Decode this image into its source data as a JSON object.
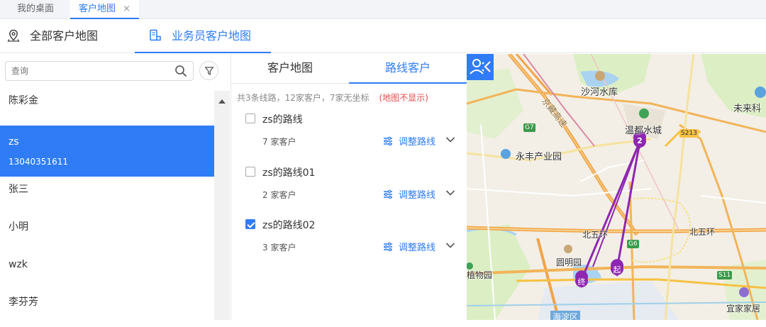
{
  "page_tabs": [
    {
      "label": "我的桌面"
    },
    {
      "label": "客户地图",
      "close": "×"
    }
  ],
  "map_modes": [
    {
      "label": "全部客户地图",
      "icon": "map-pin-icon"
    },
    {
      "label": "业务员客户地图",
      "icon": "person-map-icon"
    }
  ],
  "search": {
    "placeholder": "查询"
  },
  "salespersons": [
    {
      "name": "陈彩金"
    },
    {
      "name": "zs",
      "phone": "13040351611"
    },
    {
      "name": "张三"
    },
    {
      "name": "小明"
    },
    {
      "name": "wzk"
    },
    {
      "name": "李芬芳"
    }
  ],
  "sub_tabs": [
    "客户地图",
    "路线客户"
  ],
  "summary": {
    "text": "共3条线路，12家客户，7家无坐标",
    "note": "(地图不显示)"
  },
  "routes": [
    {
      "name": "zs的路线",
      "count": "7 家客户",
      "action": "调整路线",
      "checked": false
    },
    {
      "name": "zs的路线01",
      "count": "2 家客户",
      "action": "调整路线",
      "checked": false
    },
    {
      "name": "zs的路线02",
      "count": "3 家客户",
      "action": "调整路线",
      "checked": true
    }
  ],
  "map": {
    "labels": {
      "shahe": "沙河水库",
      "wendu": "温都水城",
      "yongfeng": "永丰产业园",
      "weilai": "未来科",
      "beiwuhuan_w": "北五环",
      "beiwuhuan_e": "北五环",
      "yuanmingyuan": "圆明园",
      "zhiwuyuan": "植物园",
      "yijia": "宜家家居",
      "haidian": "海淀区",
      "jingzang": "京藏高速"
    },
    "shields": {
      "s213": "S213",
      "g7": "G7",
      "g6": "G6",
      "s11": "S11"
    },
    "markers": {
      "cluster": "2",
      "start": "起",
      "end": "终"
    },
    "colors": {
      "route": "#8e27b0",
      "primary": "#2f7cf6"
    }
  }
}
